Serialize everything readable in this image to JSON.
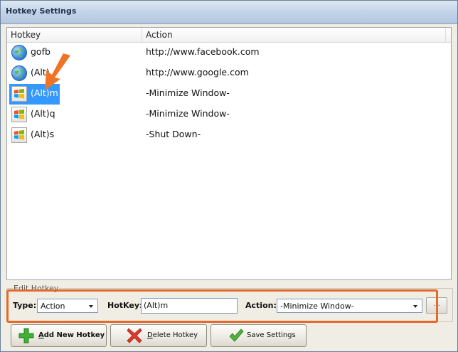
{
  "window": {
    "title": "Hotkey Settings"
  },
  "list": {
    "columns": {
      "hotkey": "Hotkey",
      "action": "Action"
    },
    "rows": [
      {
        "hotkey": "gofb",
        "action": "http://www.facebook.com",
        "icon": "globe-icon",
        "selected": false
      },
      {
        "hotkey": "(Alt)",
        "action": "http://www.google.com",
        "icon": "globe-icon",
        "selected": false
      },
      {
        "hotkey": "(Alt)m",
        "action": "-Minimize Window-",
        "icon": "windows-logo-icon",
        "selected": true
      },
      {
        "hotkey": "(Alt)q",
        "action": "-Minimize Window-",
        "icon": "windows-logo-icon",
        "selected": false
      },
      {
        "hotkey": "(Alt)s",
        "action": "-Shut Down-",
        "icon": "windows-logo-icon",
        "selected": false
      }
    ]
  },
  "edit": {
    "group_label": "Edit Hotkey",
    "type_label": "Type:",
    "type_value": "Action",
    "hotkey_label": "HotKey:",
    "hotkey_value": "(Alt)m",
    "action_label": "Action:",
    "action_value": "-Minimize Window-",
    "browse_label": "..."
  },
  "buttons": {
    "add": "Add New Hotkey",
    "delete": "Delete Hotkey",
    "save": "Save Settings"
  },
  "colors": {
    "selection": "#3399ff",
    "highlight": "#e4692a",
    "pointer": "#f07424",
    "add_icon": "#3fb135",
    "delete_icon": "#e0382a",
    "save_icon": "#4db33d"
  }
}
